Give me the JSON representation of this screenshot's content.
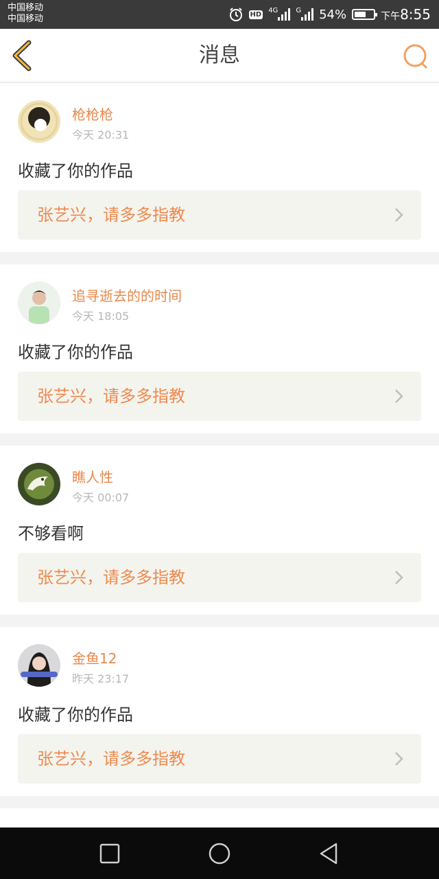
{
  "status_bar": {
    "carrier1": "中国移动",
    "carrier2": "中国移动",
    "battery": "54%",
    "time_prefix": "下午",
    "time": "8:55",
    "icons": [
      "alarm-icon",
      "hd-icon",
      "4g-signal-icon",
      "g-signal-icon",
      "battery-icon"
    ]
  },
  "header": {
    "title": "消息",
    "back_icon": "back-chevron-icon",
    "search_icon": "search-icon",
    "accent": "#f0a15f"
  },
  "messages": [
    {
      "user": "枪枪枪",
      "time": "今天 20:31",
      "action": "收藏了你的作品",
      "work": "张艺兴，请多多指教"
    },
    {
      "user": "追寻逝去的的时间",
      "time": "今天 18:05",
      "action": "收藏了你的作品",
      "work": "张艺兴，请多多指教"
    },
    {
      "user": "瞧人性",
      "time": "今天 00:07",
      "action": "不够看啊",
      "work": "张艺兴，请多多指教"
    },
    {
      "user": "金鱼12",
      "time": "昨天 23:17",
      "action": "收藏了你的作品",
      "work": "张艺兴，请多多指教"
    }
  ],
  "colors": {
    "username": "#e8874a",
    "work_title": "#ee8a4f",
    "work_bg": "#f4f4ee"
  },
  "nav": {
    "icons": [
      "recent-apps-icon",
      "home-icon",
      "back-icon"
    ]
  }
}
